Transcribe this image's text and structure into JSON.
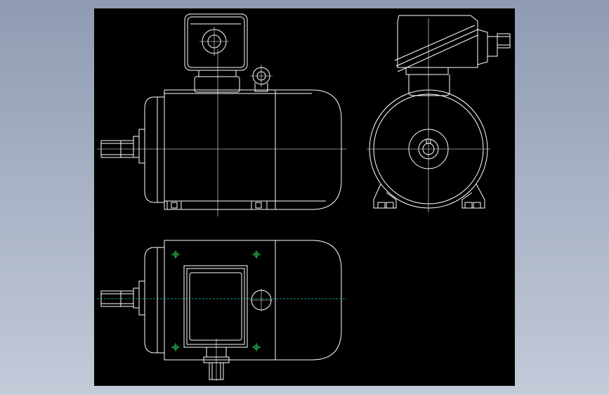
{
  "colors": {
    "background_top": "#8e9bb2",
    "background_bottom": "#c3cad8",
    "viewport": "#000000",
    "line": "#ffffff",
    "centerline_cyan": "#23c6c6",
    "hole_green": "#2fd05a"
  },
  "views": [
    "front-view",
    "side-view",
    "top-view"
  ]
}
